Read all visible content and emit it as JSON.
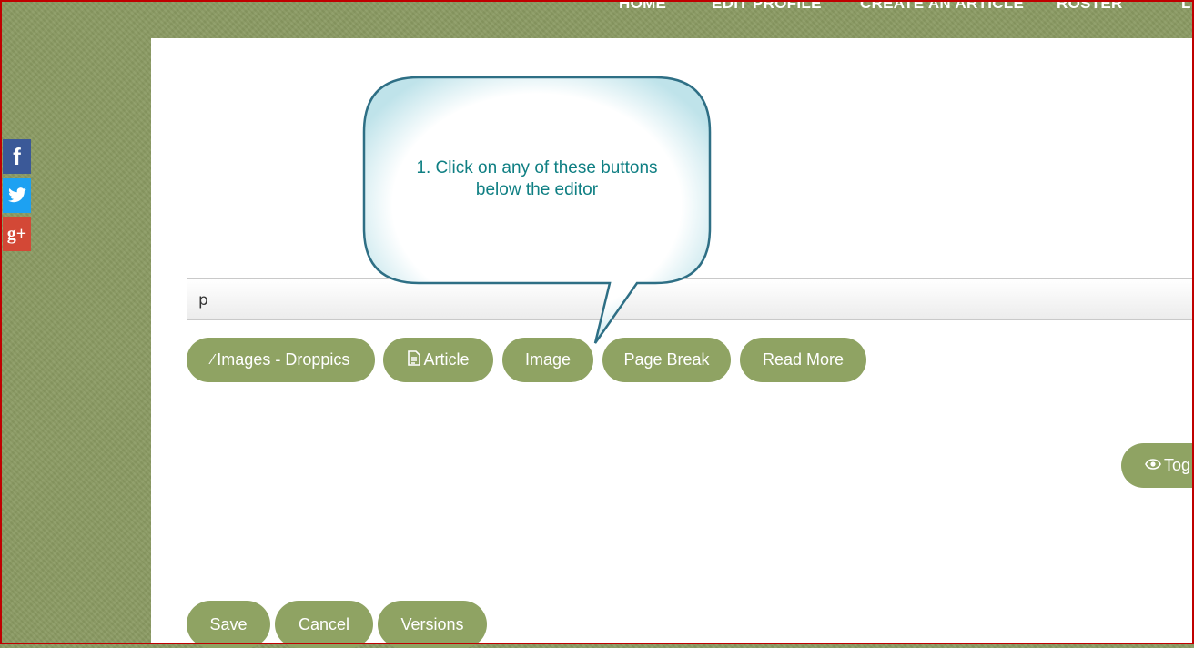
{
  "nav": {
    "items": [
      "HOME",
      "EDIT PROFILE",
      "CREATE AN ARTICLE",
      "ROSTER",
      "L"
    ]
  },
  "social": {
    "facebook": "f",
    "twitter": "t",
    "googleplus": "g+"
  },
  "editor": {
    "path_label": "p"
  },
  "editor_buttons": {
    "images_droppics": "Images - Droppics",
    "article": "Article",
    "image": "Image",
    "page_break": "Page Break",
    "read_more": "Read More"
  },
  "toggle_button": "Tog",
  "actions": {
    "save": "Save",
    "cancel": "Cancel",
    "versions": "Versions"
  },
  "callout": {
    "line1": "1. Click on any of these buttons",
    "line2": "below the editor"
  },
  "colors": {
    "page_bg": "#8a9a62",
    "button": "#8fa363",
    "callout_text": "#0f7f83",
    "callout_border": "#2e6f85",
    "frame": "#c00000"
  }
}
